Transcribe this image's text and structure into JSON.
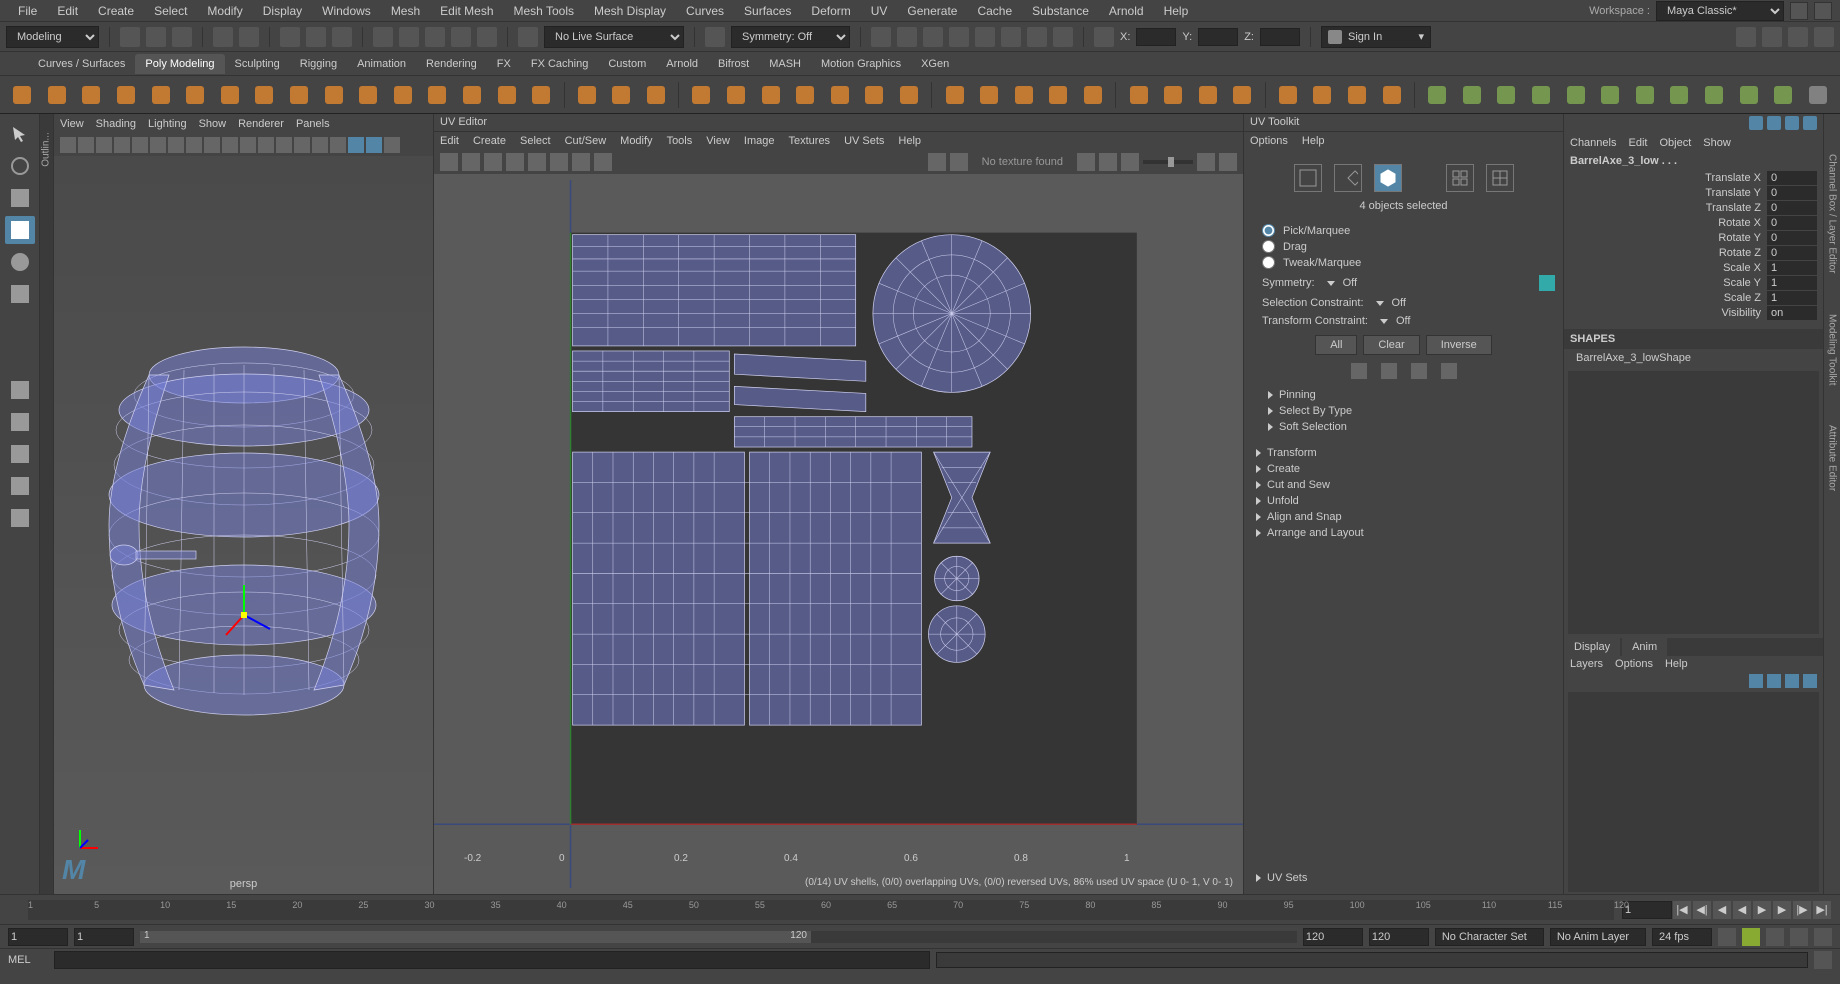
{
  "menubar": {
    "items": [
      "File",
      "Edit",
      "Create",
      "Select",
      "Modify",
      "Display",
      "Windows",
      "Mesh",
      "Edit Mesh",
      "Mesh Tools",
      "Mesh Display",
      "Curves",
      "Surfaces",
      "Deform",
      "UV",
      "Generate",
      "Cache",
      "Substance",
      "Arnold",
      "Help"
    ],
    "workspace_label": "Workspace :",
    "workspace": "Maya Classic*"
  },
  "statusline": {
    "module": "Modeling",
    "nls": "No Live Surface",
    "symmetry": "Symmetry: Off",
    "x": "X:",
    "y": "Y:",
    "z": "Z:",
    "signin": "Sign In"
  },
  "shelftabs": [
    "Curves / Surfaces",
    "Poly Modeling",
    "Sculpting",
    "Rigging",
    "Animation",
    "Rendering",
    "FX",
    "FX Caching",
    "Custom",
    "Arnold",
    "Bifrost",
    "MASH",
    "Motion Graphics",
    "XGen"
  ],
  "active_shelf": 1,
  "panelmenu": [
    "View",
    "Shading",
    "Lighting",
    "Show",
    "Renderer",
    "Panels"
  ],
  "persp": "persp",
  "outliner_label": "Outlin...",
  "uveditor": {
    "title": "UV Editor",
    "menu": [
      "Edit",
      "Create",
      "Select",
      "Cut/Sew",
      "Modify",
      "Tools",
      "View",
      "Image",
      "Textures",
      "UV Sets",
      "Help"
    ],
    "notex": "No texture found",
    "status": "(0/14) UV shells, (0/0) overlapping UVs, (0/0) reversed UVs, 86% used UV space (U  0- 1, V  0- 1)",
    "axis": {
      "a": "-0.2",
      "b": "0",
      "c": "0.2",
      "d": "0.4",
      "e": "0.6",
      "f": "0.8",
      "g": "1"
    }
  },
  "uvtoolkit": {
    "title": "UV Toolkit",
    "menu": [
      "Options",
      "Help"
    ],
    "selected": "4 objects selected",
    "modes": [
      "Pick/Marquee",
      "Drag",
      "Tweak/Marquee"
    ],
    "symmetry_label": "Symmetry:",
    "symmetry": "Off",
    "selconst_label": "Selection Constraint:",
    "selconst": "Off",
    "transconst_label": "Transform Constraint:",
    "transconst": "Off",
    "btns": {
      "all": "All",
      "clear": "Clear",
      "inverse": "Inverse"
    },
    "open_sections": [
      "Pinning",
      "Select By Type",
      "Soft Selection"
    ],
    "sections": [
      "Transform",
      "Create",
      "Cut and Sew",
      "Unfold",
      "Align and Snap",
      "Arrange and Layout"
    ],
    "uvsets": "UV Sets"
  },
  "channelbox": {
    "menu": [
      "Channels",
      "Edit",
      "Object",
      "Show"
    ],
    "obj": "BarrelAxe_3_low . . .",
    "attrs": [
      {
        "l": "Translate X",
        "v": "0"
      },
      {
        "l": "Translate Y",
        "v": "0"
      },
      {
        "l": "Translate Z",
        "v": "0"
      },
      {
        "l": "Rotate X",
        "v": "0"
      },
      {
        "l": "Rotate Y",
        "v": "0"
      },
      {
        "l": "Rotate Z",
        "v": "0"
      },
      {
        "l": "Scale X",
        "v": "1"
      },
      {
        "l": "Scale Y",
        "v": "1"
      },
      {
        "l": "Scale Z",
        "v": "1"
      },
      {
        "l": "Visibility",
        "v": "on"
      }
    ],
    "shapes_label": "SHAPES",
    "shape": "BarrelAxe_3_lowShape",
    "layertabs": [
      "Display",
      "Anim"
    ],
    "layermenu": [
      "Layers",
      "Options",
      "Help"
    ]
  },
  "rightcol": [
    "Channel Box / Layer Editor",
    "Modeling Toolkit",
    "Attribute Editor"
  ],
  "timeline": {
    "ticks": [
      "1",
      "5",
      "10",
      "15",
      "20",
      "25",
      "30",
      "35",
      "40",
      "45",
      "50",
      "55",
      "60",
      "65",
      "70",
      "75",
      "80",
      "85",
      "90",
      "95",
      "100",
      "105",
      "110",
      "115",
      "120"
    ],
    "cur": "1"
  },
  "range": {
    "startA": "1",
    "startB": "1",
    "endA": "120",
    "endB": "120",
    "mid": "120",
    "charset": "No Character Set",
    "animlayer": "No Anim Layer",
    "fps": "24 fps"
  },
  "cmd": {
    "lang": "MEL"
  }
}
